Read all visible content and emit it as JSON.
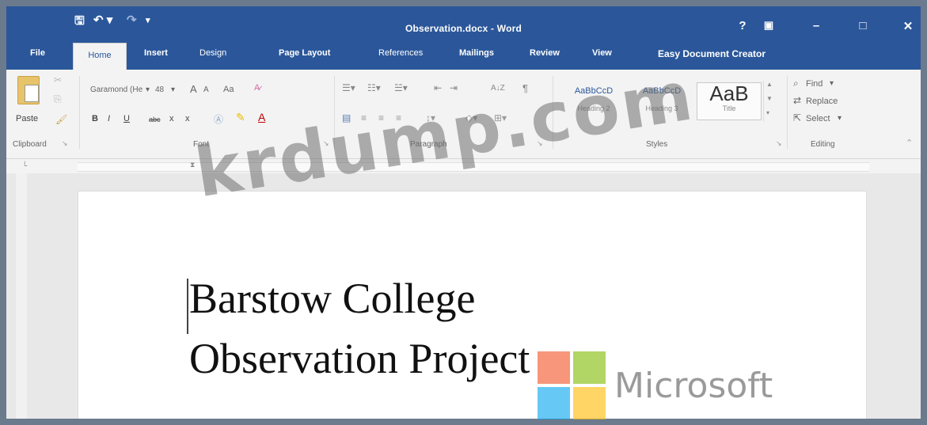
{
  "window": {
    "title": "Observation.docx - Word",
    "help": "?",
    "minimize": "–",
    "maximize": "□",
    "close": "✕"
  },
  "qat": {
    "save_icon": "save-icon",
    "undo_icon": "undo-icon",
    "redo_icon": "redo-icon",
    "customize_icon": "customize-icon"
  },
  "tabs": [
    {
      "label": "File"
    },
    {
      "label": "Home"
    },
    {
      "label": "Insert"
    },
    {
      "label": "Design"
    },
    {
      "label": "Page Layout"
    },
    {
      "label": "References"
    },
    {
      "label": "Mailings"
    },
    {
      "label": "Review"
    },
    {
      "label": "View"
    },
    {
      "label": "Easy Document Creator"
    }
  ],
  "ribbon": {
    "clipboard": {
      "paste": "Paste",
      "label": "Clipboard"
    },
    "font": {
      "name": "Garamond (He",
      "size": "48",
      "grow": "A",
      "shrink": "A",
      "case": "Aa",
      "bold": "B",
      "italic": "I",
      "underline": "U",
      "strike": "abc",
      "sub": "x",
      "sup": "x",
      "label": "Font"
    },
    "paragraph": {
      "label": "Paragraph",
      "sort": "A↓Z",
      "pilcrow": "¶"
    },
    "styles": {
      "items": [
        {
          "sample": "AaBbCcD",
          "name": "Heading 2"
        },
        {
          "sample": "AaBbCcD",
          "name": "Heading 3"
        },
        {
          "sample": "AaB",
          "name": "Title"
        }
      ],
      "label": "Styles"
    },
    "editing": {
      "find": "Find",
      "replace": "Replace",
      "select": "Select",
      "label": "Editing"
    }
  },
  "document": {
    "line1": "Barstow College",
    "line2": "Observation Project"
  },
  "watermarks": {
    "site": "krdump.com",
    "brand": "Microsoft"
  },
  "colors": {
    "word_blue": "#2b579a",
    "ms_red": "#f25022",
    "ms_green": "#7fba00",
    "ms_blue": "#00a4ef",
    "ms_yellow": "#ffb900"
  }
}
